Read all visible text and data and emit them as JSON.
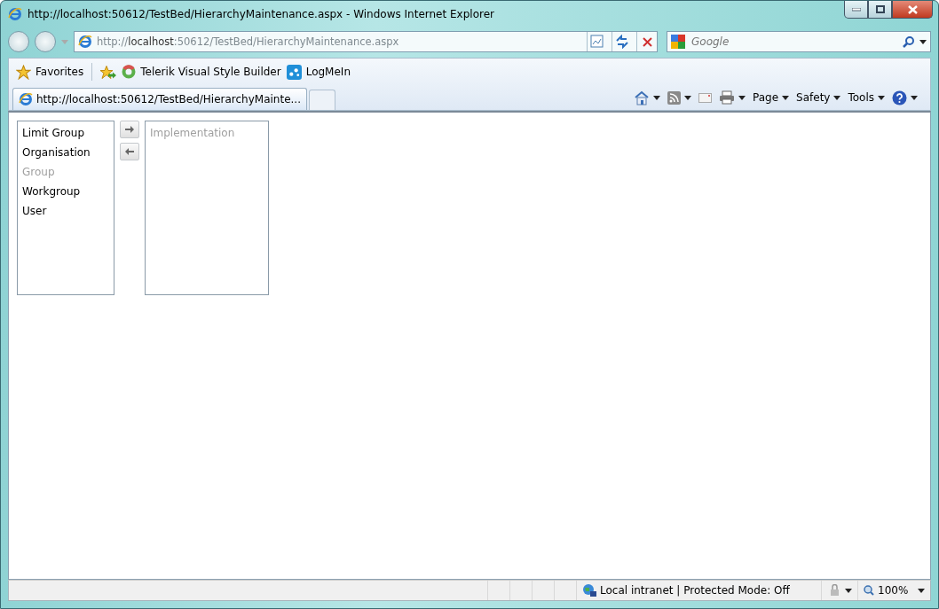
{
  "window": {
    "title": "http://localhost:50612/TestBed/HierarchyMaintenance.aspx - Windows Internet Explorer"
  },
  "address_bar": {
    "prefix": "http://",
    "host": "localhost",
    "rest": ":50612/TestBed/HierarchyMaintenance.aspx"
  },
  "search": {
    "placeholder": "Google"
  },
  "favorites_bar": [
    {
      "kind": "favorites",
      "label": "Favorites"
    },
    {
      "kind": "add"
    },
    {
      "kind": "telerik",
      "label": "Telerik Visual Style Builder"
    },
    {
      "kind": "logmein",
      "label": "LogMeIn"
    }
  ],
  "tabs": [
    {
      "label": "http://localhost:50612/TestBed/HierarchyMainte...",
      "selected": true
    }
  ],
  "command_bar": [
    {
      "kind": "home"
    },
    {
      "kind": "feed"
    },
    {
      "kind": "mail"
    },
    {
      "kind": "print"
    },
    {
      "kind": "menu",
      "label": "Page"
    },
    {
      "kind": "menu",
      "label": "Safety"
    },
    {
      "kind": "menu",
      "label": "Tools"
    },
    {
      "kind": "help"
    }
  ],
  "available_list": [
    {
      "label": "Limit Group",
      "disabled": false
    },
    {
      "label": "Organisation",
      "disabled": false
    },
    {
      "label": "Group",
      "disabled": true
    },
    {
      "label": "Workgroup",
      "disabled": false
    },
    {
      "label": "User",
      "disabled": false
    }
  ],
  "selected_list": [
    {
      "label": "Implementation",
      "disabled": true
    }
  ],
  "status_bar": {
    "zone": "Local intranet | Protected Mode: Off",
    "zoom": "100%"
  }
}
